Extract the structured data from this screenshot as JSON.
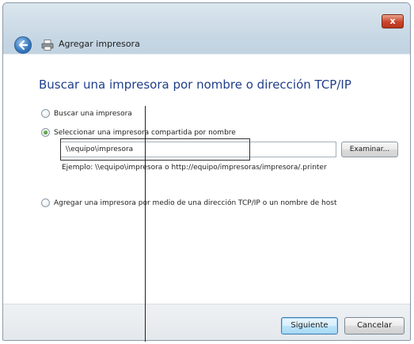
{
  "window": {
    "title": "Agregar impresora",
    "close_label": "x"
  },
  "main": {
    "heading": "Buscar una impresora por nombre o dirección TCP/IP",
    "options": [
      {
        "label": "Buscar una impresora",
        "checked": false
      },
      {
        "label": "Seleccionar una impresora compartida por nombre",
        "checked": true
      },
      {
        "label": "Agregar una impresora por medio de una dirección TCP/IP o un nombre de host",
        "checked": false
      }
    ],
    "printer_name_value": "\\\\equipo\\impresora",
    "browse_label": "Examinar...",
    "example_text": "Ejemplo: \\\\equipo\\impresora o http://equipo/impresoras/impresora/.printer"
  },
  "footer": {
    "next_label": "Siguiente",
    "cancel_label": "Cancelar"
  },
  "colors": {
    "heading": "#1f3f8a",
    "accent_button": "#3c7fb1",
    "close_button": "#c9442a"
  }
}
